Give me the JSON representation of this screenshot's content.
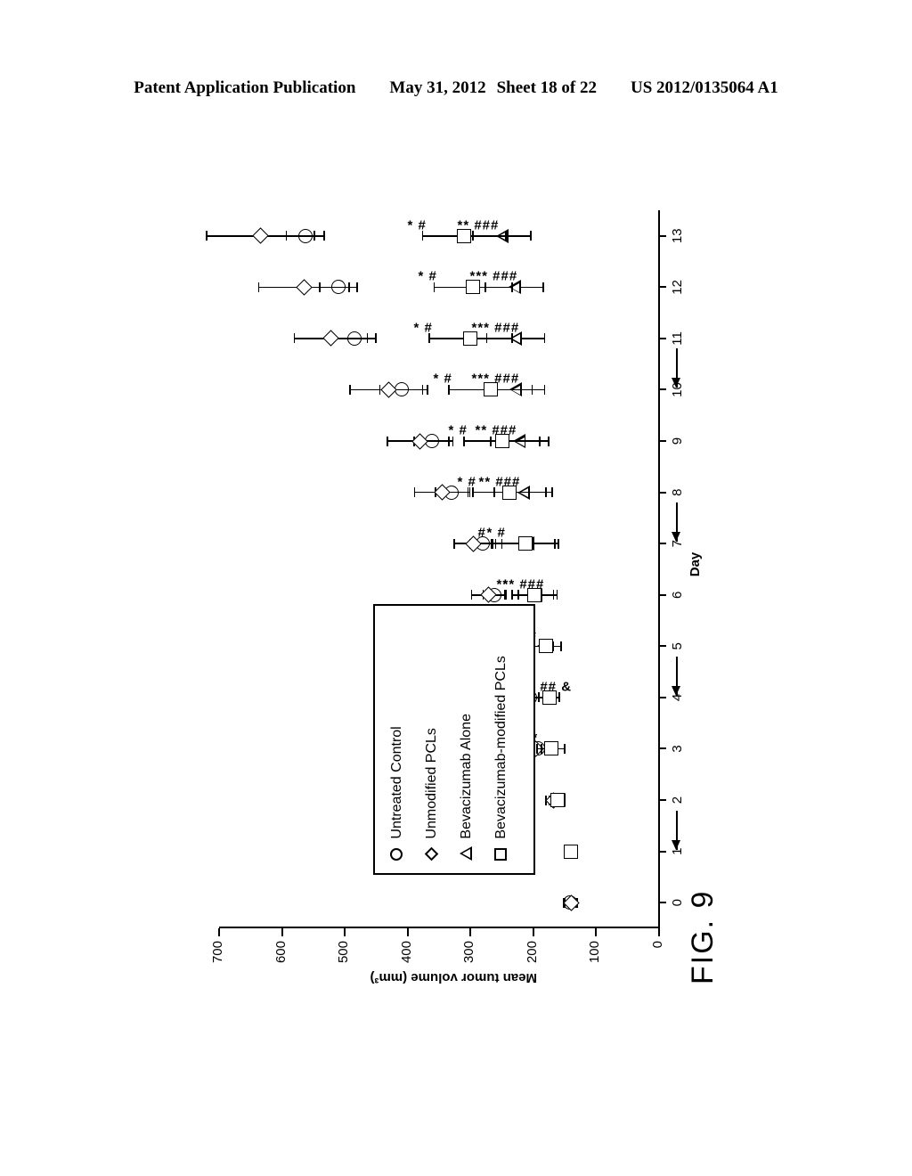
{
  "header": {
    "publication": "Patent Application Publication",
    "date": "May 31, 2012",
    "sheet": "Sheet 18 of 22",
    "doc_number": "US 2012/0135064 A1"
  },
  "figure": {
    "label": "FIG. 9",
    "orientation": "rotated-90"
  },
  "legend": {
    "items": [
      {
        "marker": "circle-marker",
        "label": "Untreated Control"
      },
      {
        "marker": "diamond-marker",
        "label": "Unmodified PCLs"
      },
      {
        "marker": "triangle-marker",
        "label": "Bevacizumab Alone"
      },
      {
        "marker": "square-marker",
        "label": "Bevacizumab-modified PCLs"
      }
    ]
  },
  "chart_data": {
    "type": "line",
    "title": "FIG. 9",
    "xlabel": "Day",
    "ylabel": "Mean tumor volume (mm³)",
    "x": [
      0,
      1,
      2,
      3,
      4,
      5,
      6,
      7,
      8,
      9,
      10,
      11,
      12,
      13
    ],
    "xtick_labels": [
      "0",
      "1",
      "2",
      "3",
      "4",
      "5",
      "6",
      "7",
      "8",
      "9",
      "10",
      "11",
      "12",
      "13"
    ],
    "xlim": [
      -0.5,
      13.5
    ],
    "ylim": [
      0,
      700
    ],
    "ytick_labels": [
      "0",
      "100",
      "200",
      "300",
      "400",
      "500",
      "600",
      "700"
    ],
    "yticks": [
      0,
      100,
      200,
      300,
      400,
      500,
      600,
      700
    ],
    "grid": false,
    "legend_position": "inside-left",
    "treatment_arrows_at_days": [
      1,
      4,
      7,
      10
    ],
    "series": [
      {
        "name": "Untreated Control",
        "marker": "circle",
        "x": [
          0,
          2,
          3,
          4,
          5,
          6,
          7,
          8,
          9,
          10,
          11,
          12,
          13
        ],
        "values": [
          142,
          165,
          193,
          205,
          232,
          262,
          280,
          330,
          362,
          410,
          485,
          510,
          563
        ],
        "errors": [
          10,
          10,
          14,
          14,
          16,
          18,
          20,
          26,
          28,
          34,
          34,
          30,
          30
        ]
      },
      {
        "name": "Unmodified PCLs",
        "marker": "diamond",
        "x": [
          0,
          2,
          3,
          4,
          5,
          6,
          7,
          8,
          9,
          10,
          11,
          12,
          13
        ],
        "values": [
          140,
          168,
          196,
          210,
          238,
          272,
          296,
          345,
          380,
          430,
          522,
          565,
          634
        ],
        "errors": [
          10,
          12,
          18,
          18,
          22,
          26,
          30,
          44,
          52,
          62,
          58,
          72,
          86
        ]
      },
      {
        "name": "Bevacizumab Alone",
        "marker": "triangle",
        "x": [
          2,
          3,
          4,
          5,
          6,
          7,
          8,
          9,
          10,
          11,
          12,
          13
        ],
        "values": [
          158,
          175,
          178,
          184,
          196,
          208,
          216,
          222,
          228,
          228,
          230,
          250
        ],
        "errors": [
          0,
          12,
          14,
          16,
          28,
          42,
          46,
          46,
          46,
          46,
          46,
          46
        ],
        "significance": {
          "3": "**",
          "4": "** ## &",
          "5": "* #",
          "6": "** ###",
          "7": "* #",
          "8": "** ###",
          "9": "** ###",
          "10": "*** ###",
          "11": "*** ###",
          "12": "*** ###",
          "13": "** ###"
        }
      },
      {
        "name": "Bevacizumab-modified PCLs",
        "marker": "square",
        "x": [
          1,
          2,
          3,
          4,
          5,
          6,
          7,
          8,
          9,
          10,
          11,
          12,
          13
        ],
        "values": [
          140,
          162,
          172,
          175,
          180,
          198,
          212,
          238,
          250,
          268,
          300,
          296,
          310
        ],
        "errors": [
          0,
          10,
          22,
          16,
          24,
          36,
          52,
          58,
          60,
          66,
          66,
          62,
          66
        ],
        "significance": {
          "6": "**",
          "7": "#",
          "8": "* #",
          "9": "* #",
          "10": "* #",
          "11": "* #",
          "12": "* #",
          "13": "* #"
        }
      }
    ]
  }
}
